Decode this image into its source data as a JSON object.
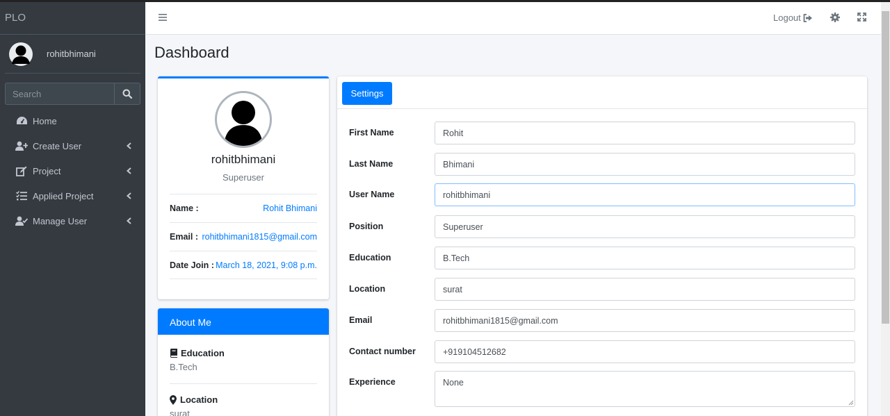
{
  "brand": "PLO",
  "sidebar": {
    "username": "rohitbhimani",
    "search_placeholder": "Search",
    "items": [
      {
        "label": "Home",
        "icon": "tachometer-icon"
      },
      {
        "label": "Create User",
        "icon": "user-plus-icon"
      },
      {
        "label": "Project",
        "icon": "edit-icon"
      },
      {
        "label": "Applied Project",
        "icon": "tasks-icon"
      },
      {
        "label": "Manage User",
        "icon": "user-check-icon"
      }
    ]
  },
  "topbar": {
    "logout_label": "Logout"
  },
  "page": {
    "title": "Dashboard"
  },
  "profile": {
    "name": "rohitbhimani",
    "role": "Superuser",
    "rows": [
      {
        "label": "Name :",
        "value": "Rohit Bhimani"
      },
      {
        "label": "Email :",
        "value": "rohitbhimani1815@gmail.com"
      },
      {
        "label": "Date Join :",
        "value": "March 18, 2021, 9:08 p.m."
      }
    ]
  },
  "about": {
    "title": "About Me",
    "education_label": "Education",
    "education_value": "B.Tech",
    "location_label": "Location",
    "location_value": "surat"
  },
  "settings": {
    "tab_label": "Settings",
    "fields": [
      {
        "label": "First Name",
        "value": "Rohit"
      },
      {
        "label": "Last Name",
        "value": "Bhimani"
      },
      {
        "label": "User Name",
        "value": "rohitbhimani"
      },
      {
        "label": "Position",
        "value": "Superuser"
      },
      {
        "label": "Education",
        "value": "B.Tech"
      },
      {
        "label": "Location",
        "value": "surat"
      },
      {
        "label": "Email",
        "value": "rohitbhimani1815@gmail.com"
      },
      {
        "label": "Contact number",
        "value": "+919104512682"
      },
      {
        "label": "Experience",
        "value": "None"
      }
    ]
  },
  "colors": {
    "accent": "#007bff",
    "sidebar_bg": "#343a40"
  }
}
